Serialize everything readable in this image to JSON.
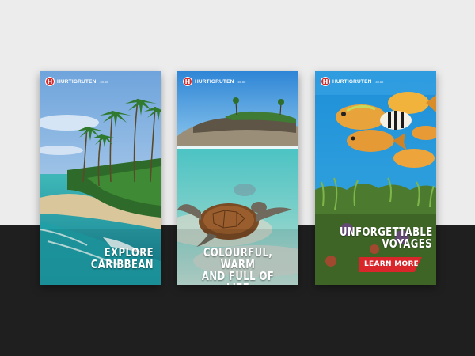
{
  "brand": {
    "name": "HURTIGRUTEN",
    "suffix": ".co.uk",
    "mark": "H"
  },
  "ads": [
    {
      "headline_lines": [
        "EXPLORE",
        "CARIBBEAN"
      ]
    },
    {
      "headline_lines": [
        "COLOURFUL, WARM",
        "AND FULL OF LIFE"
      ]
    },
    {
      "headline_lines": [
        "UNFORGETTABLE",
        "VOYAGES"
      ],
      "cta": "LEARN MORE"
    }
  ],
  "colors": {
    "brand_red": "#d62b2b",
    "cta_red": "#d9262a",
    "bg_light": "#ececec",
    "bg_dark": "#1f1f1f"
  }
}
